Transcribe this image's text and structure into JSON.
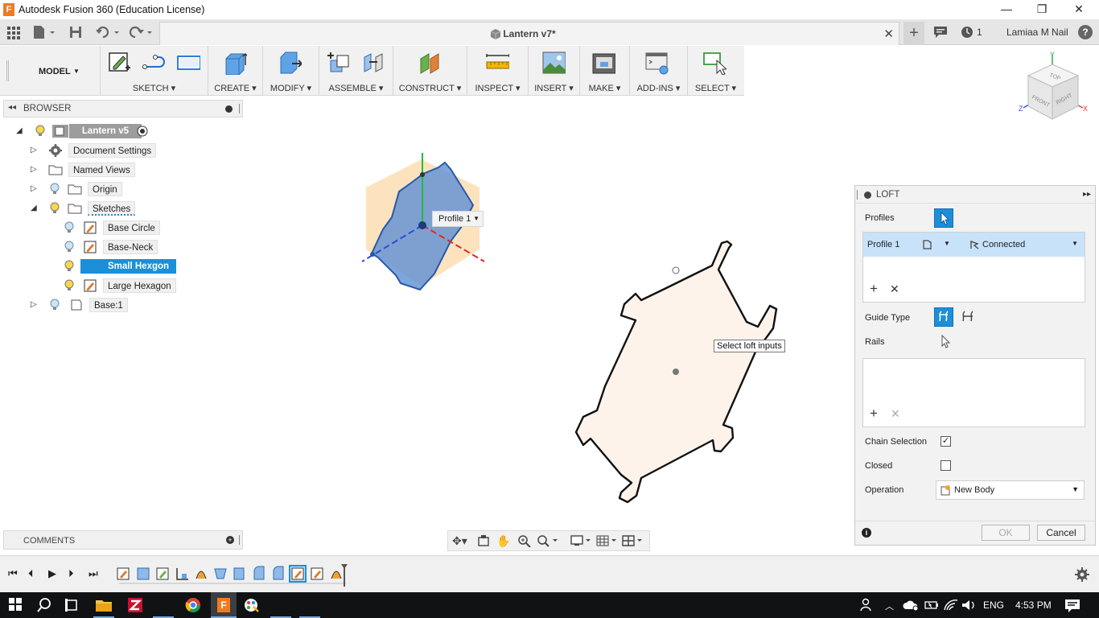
{
  "window": {
    "app_icon_letter": "F",
    "title": "Autodesk Fusion 360 (Education License)",
    "minimize": "—",
    "restore": "❐",
    "close": "✕"
  },
  "tabbar": {
    "doc_title": "Lantern v7*",
    "tab_close": "✕",
    "job_count": "1",
    "user": "Lamiaa M Nail",
    "help": "?"
  },
  "toolbar": {
    "workspace": "MODEL",
    "groups": {
      "sketch": "SKETCH",
      "create": "CREATE",
      "modify": "MODIFY",
      "assemble": "ASSEMBLE",
      "construct": "CONSTRUCT",
      "inspect": "INSPECT",
      "insert": "INSERT",
      "make": "MAKE",
      "addins": "ADD-INS",
      "select": "SELECT"
    }
  },
  "browser": {
    "title": "BROWSER",
    "root": "Lantern v5",
    "items": {
      "document_settings": "Document Settings",
      "named_views": "Named Views",
      "origin": "Origin",
      "sketches": "Sketches",
      "base_circle": "Base Circle",
      "base_neck": "Base-Neck",
      "small_hexagon": "Small Hexgon",
      "large_hexagon": "Large Hexagon",
      "base_body": "Base:1"
    }
  },
  "comments": {
    "title": "COMMENTS"
  },
  "canvas": {
    "profile_pill": "Profile 1",
    "tooltip": "Select loft inputs"
  },
  "viewcube": {
    "top": "TOP",
    "front": "FRONT",
    "right": "RIGHT",
    "axis_x": "X",
    "axis_y": "Y",
    "axis_z": "Z"
  },
  "loft": {
    "title": "LOFT",
    "profiles_label": "Profiles",
    "profile_row_name": "Profile 1",
    "profile_row_condition": "Connected",
    "guide_type_label": "Guide Type",
    "rails_label": "Rails",
    "chain_selection_label": "Chain Selection",
    "chain_selection_checked": "✓",
    "closed_label": "Closed",
    "operation_label": "Operation",
    "operation_value": "New Body",
    "ok": "OK",
    "cancel": "Cancel"
  },
  "taskbar": {
    "language": "ENG",
    "time": "4:53 PM"
  },
  "colors": {
    "accent_blue": "#1e8ed9",
    "selection_blue": "#1b8fd8",
    "profile_fill": "#fdf3ea",
    "sketch_blue": "#5c8fd6",
    "sketch_orange": "#fbd9a8"
  }
}
